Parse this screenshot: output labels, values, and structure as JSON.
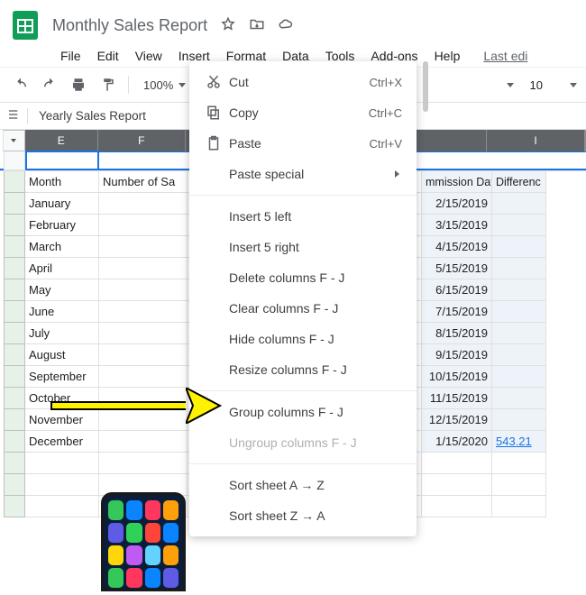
{
  "doc_title": "Monthly Sales Report",
  "menubar": {
    "file": "File",
    "edit": "Edit",
    "view": "View",
    "insert": "Insert",
    "format": "Format",
    "data": "Data",
    "tools": "Tools",
    "addons": "Add-ons",
    "help": "Help",
    "last_edit": "Last edi"
  },
  "toolbar": {
    "zoom": "100%",
    "font_size": "10"
  },
  "sheet_tab": "Yearly Sales Report",
  "columns": {
    "e": "E",
    "f": "F",
    "i": "I"
  },
  "header_row": {
    "month": "Month",
    "num_sales": "Number of Sa",
    "comm_date": "mmission Date",
    "diff": "Differenc"
  },
  "rows": [
    {
      "month": "January",
      "date": "2/15/2019"
    },
    {
      "month": "February",
      "date": "3/15/2019"
    },
    {
      "month": "March",
      "date": "4/15/2019"
    },
    {
      "month": "April",
      "date": "5/15/2019"
    },
    {
      "month": "May",
      "date": "6/15/2019"
    },
    {
      "month": "June",
      "date": "7/15/2019"
    },
    {
      "month": "July",
      "date": "8/15/2019"
    },
    {
      "month": "August",
      "date": "9/15/2019"
    },
    {
      "month": "September",
      "date": "10/15/2019"
    },
    {
      "month": "October",
      "date": "11/15/2019"
    },
    {
      "month": "November",
      "date": "12/15/2019"
    },
    {
      "month": "December",
      "date": "1/15/2020"
    }
  ],
  "link_val": "543.21",
  "context_menu": {
    "cut": "Cut",
    "cut_sc": "Ctrl+X",
    "copy": "Copy",
    "copy_sc": "Ctrl+C",
    "paste": "Paste",
    "paste_sc": "Ctrl+V",
    "paste_special": "Paste special",
    "insert_left": "Insert 5 left",
    "insert_right": "Insert 5 right",
    "delete": "Delete columns F - J",
    "clear": "Clear columns F - J",
    "hide": "Hide columns F - J",
    "resize": "Resize columns F - J",
    "group": "Group columns F - J",
    "ungroup": "Ungroup columns F - J",
    "sort_az": "Sort sheet A → Z",
    "sort_za": "Sort sheet Z → A"
  }
}
